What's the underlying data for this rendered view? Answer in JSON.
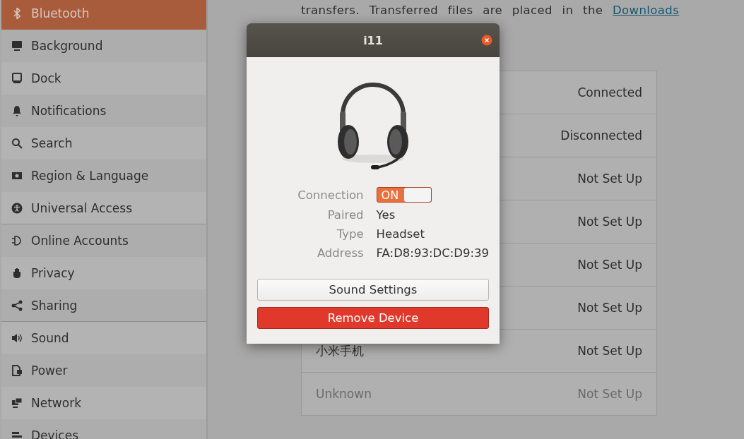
{
  "sidebar": {
    "sections": [
      {
        "items": [
          {
            "label": "Bluetooth",
            "selected": true
          },
          {
            "label": "Background",
            "selected": false
          },
          {
            "label": "Dock",
            "selected": false
          },
          {
            "label": "Notifications",
            "selected": false
          },
          {
            "label": "Search",
            "selected": false
          },
          {
            "label": "Region & Language",
            "selected": false
          },
          {
            "label": "Universal Access",
            "selected": false
          }
        ]
      },
      {
        "items": [
          {
            "label": "Online Accounts",
            "selected": false
          },
          {
            "label": "Privacy",
            "selected": false
          },
          {
            "label": "Sharing",
            "selected": false
          }
        ]
      },
      {
        "items": [
          {
            "label": "Sound",
            "selected": false
          },
          {
            "label": "Power",
            "selected": false
          },
          {
            "label": "Network",
            "selected": false
          },
          {
            "label": "Devices",
            "selected": false
          }
        ]
      }
    ]
  },
  "intro": {
    "text": "transfers. Transferred files are placed in the ",
    "link": "Downloads"
  },
  "devices": [
    {
      "status": "Connected",
      "dimmed": false
    },
    {
      "status": "Disconnected",
      "dimmed": false
    },
    {
      "status": "Not Set Up",
      "dimmed": false
    },
    {
      "status": "Not Set Up",
      "dimmed": false
    },
    {
      "status": "Not Set Up",
      "dimmed": false
    },
    {
      "status": "Not Set Up",
      "dimmed": false
    },
    {
      "name": "小米手机",
      "status": "Not Set Up",
      "dimmed": false
    },
    {
      "name": "Unknown",
      "status": "Not Set Up",
      "dimmed": true
    }
  ],
  "dialog": {
    "title": "i11",
    "connection": {
      "label": "Connection",
      "on": true,
      "on_text": "ON"
    },
    "properties": [
      {
        "label": "Paired",
        "value": "Yes"
      },
      {
        "label": "Type",
        "value": "Headset"
      },
      {
        "label": "Address",
        "value": "FA:D8:93:DC:D9:39"
      }
    ],
    "buttons": [
      {
        "label": "Sound Settings",
        "kind": "normal"
      },
      {
        "label": "Remove Device",
        "kind": "destructive"
      }
    ]
  }
}
